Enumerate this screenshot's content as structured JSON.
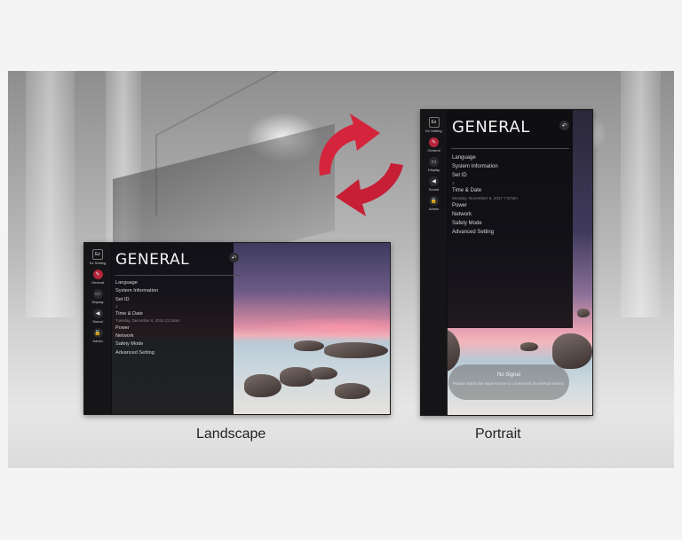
{
  "menu": {
    "title": "GENERAL",
    "back_icon": "back-arrow-icon",
    "items_landscape": [
      {
        "label": "Language"
      },
      {
        "label": "System Information"
      },
      {
        "label": "Set ID",
        "sub": "1"
      },
      {
        "label": "Time & Date",
        "sub": "Tuesday, December 6, 2016 11:18am"
      },
      {
        "label": "Power"
      },
      {
        "label": "Network"
      },
      {
        "label": "Safety Mode"
      },
      {
        "label": "Advanced Setting"
      }
    ],
    "items_portrait": [
      {
        "label": "Language"
      },
      {
        "label": "System Information"
      },
      {
        "label": "Set ID",
        "sub": "1"
      },
      {
        "label": "Time & Date",
        "sub": "Monday, November 6, 2017 7:57am"
      },
      {
        "label": "Power"
      },
      {
        "label": "Network"
      },
      {
        "label": "Safety Mode"
      },
      {
        "label": "Advanced Setting"
      }
    ]
  },
  "sidebar": {
    "items": [
      {
        "label": "Ez Setting",
        "icon": "ez-setting-icon",
        "glyph": "Ez"
      },
      {
        "label": "General",
        "icon": "general-icon",
        "glyph": "✎",
        "active": true
      },
      {
        "label": "Display",
        "icon": "display-icon",
        "glyph": "▭"
      },
      {
        "label": "Sound",
        "icon": "sound-icon",
        "glyph": "◀"
      },
      {
        "label": "Admin",
        "icon": "admin-icon",
        "glyph": "🔒"
      }
    ]
  },
  "no_signal": {
    "title": "No Signal",
    "detail": "Please check the input source or connection of external device."
  },
  "captions": {
    "landscape": "Landscape",
    "portrait": "Portrait"
  },
  "colors": {
    "accent": "#b3243a",
    "arrow": "#d4253c",
    "menu_bg": "#0c0c0e"
  }
}
